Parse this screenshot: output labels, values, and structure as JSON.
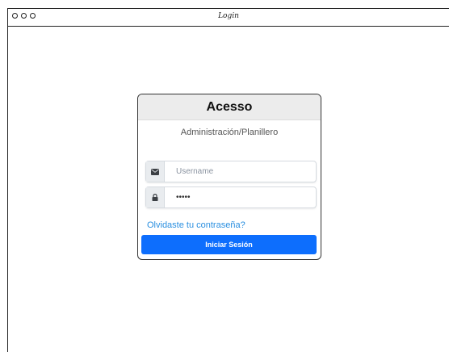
{
  "window": {
    "title": "Login"
  },
  "login": {
    "title": "Acesso",
    "subtitle": "Administración/Planillero",
    "username_placeholder": "Username",
    "password_value": "*****",
    "forgot_label": "Olvidaste tu contraseña?",
    "submit_label": "Iniciar Sesión"
  },
  "icons": {
    "username": "envelope-icon",
    "password": "lock-icon"
  },
  "colors": {
    "primary": "#0d6efd",
    "link": "#2a8fe0",
    "header_bg": "#ececec"
  }
}
